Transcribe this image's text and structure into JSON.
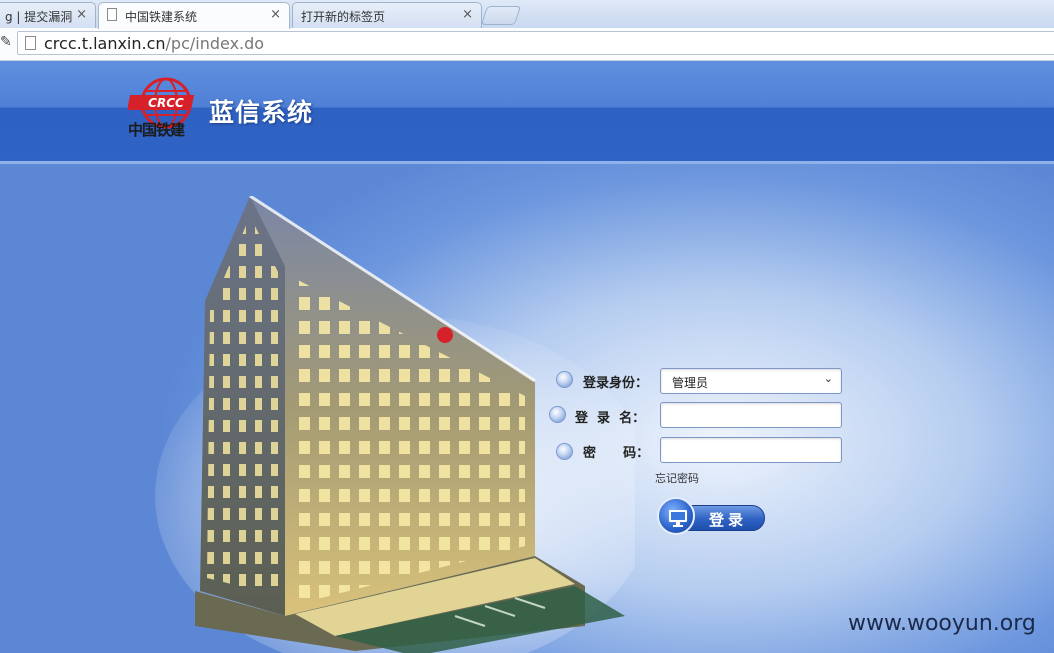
{
  "browser": {
    "tabs": [
      {
        "title": "g | 提交漏洞"
      },
      {
        "title": "中国铁建系统"
      },
      {
        "title": "打开新的标签页"
      }
    ],
    "close_glyph": "×",
    "url_host": "crcc.t.lanxin.cn",
    "url_path": "/pc/index.do"
  },
  "header": {
    "logo_badge": "CRCC",
    "logo_text": "中国铁建",
    "system_title": "蓝信系统"
  },
  "login_form": {
    "role_label": "登录身份：",
    "role_value": "管理员",
    "username_label": "登  录  名：",
    "username_value": "",
    "password_label": "密      码：",
    "password_value": "",
    "forgot_password": "忘记密码",
    "submit_label": "登录"
  },
  "watermark": "www.wooyun.org",
  "colors": {
    "header_blue": "#2f63c4",
    "page_blue": "#5b87d5",
    "button_blue": "#2f62c3",
    "logo_red": "#d6202a"
  },
  "icons": [
    "page-icon",
    "close-icon",
    "wrench-icon",
    "crcc-logo-icon",
    "building-image",
    "monitor-icon",
    "bullet-icon"
  ]
}
